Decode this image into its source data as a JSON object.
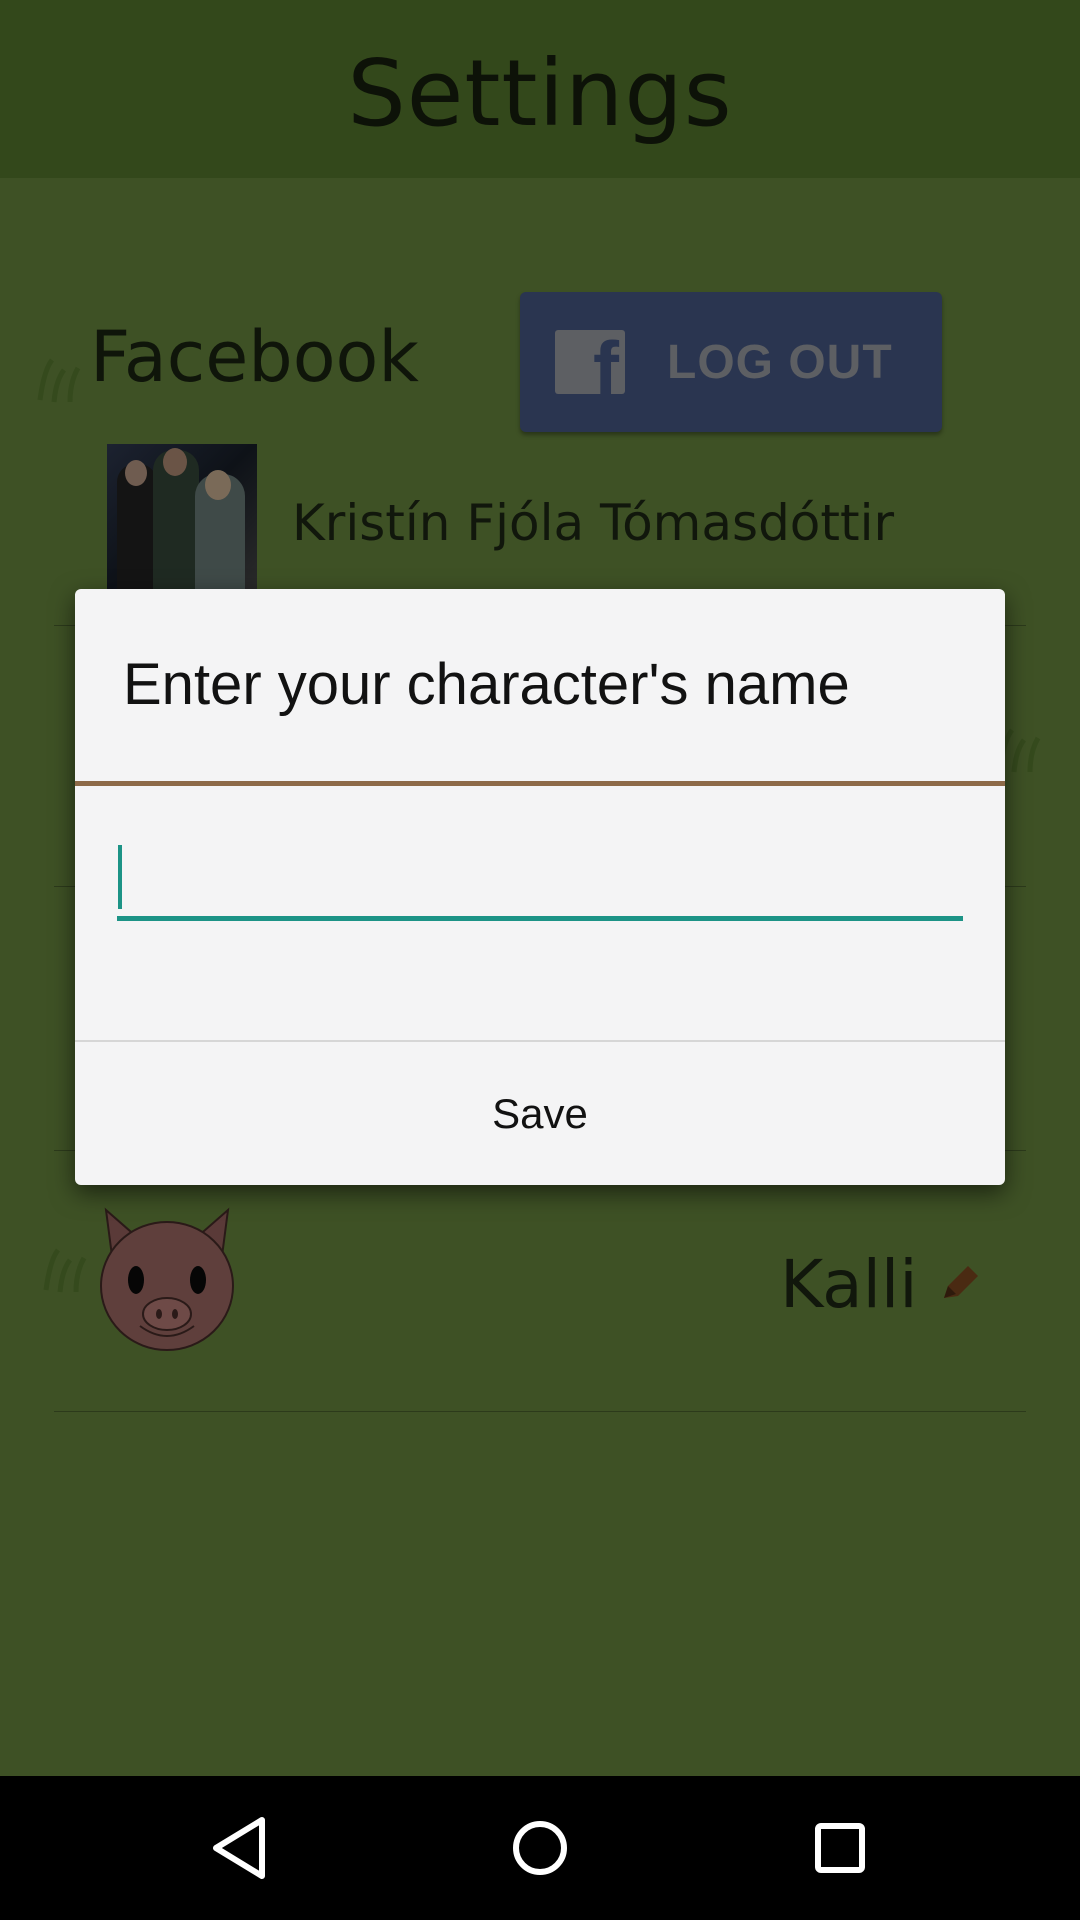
{
  "app_bar": {
    "title": "Settings"
  },
  "facebook": {
    "heading": "Facebook",
    "logout_label": "LOG OUT",
    "user_name": "Kristín Fjóla Tómasdóttir"
  },
  "character": {
    "name": "Kalli"
  },
  "dialog": {
    "title": "Enter your character's name",
    "input_value": "",
    "input_placeholder": "",
    "save_label": "Save"
  },
  "colors": {
    "app_bar": "#33481b",
    "background": "#3e5125",
    "dialog_accent": "#8d6a48",
    "input_accent": "#1c9386"
  },
  "icons": {
    "facebook_logo": "facebook-f-icon",
    "edit": "pencil-icon",
    "nav_back": "back-triangle-icon",
    "nav_home": "home-circle-icon",
    "nav_recents": "recents-square-icon"
  }
}
